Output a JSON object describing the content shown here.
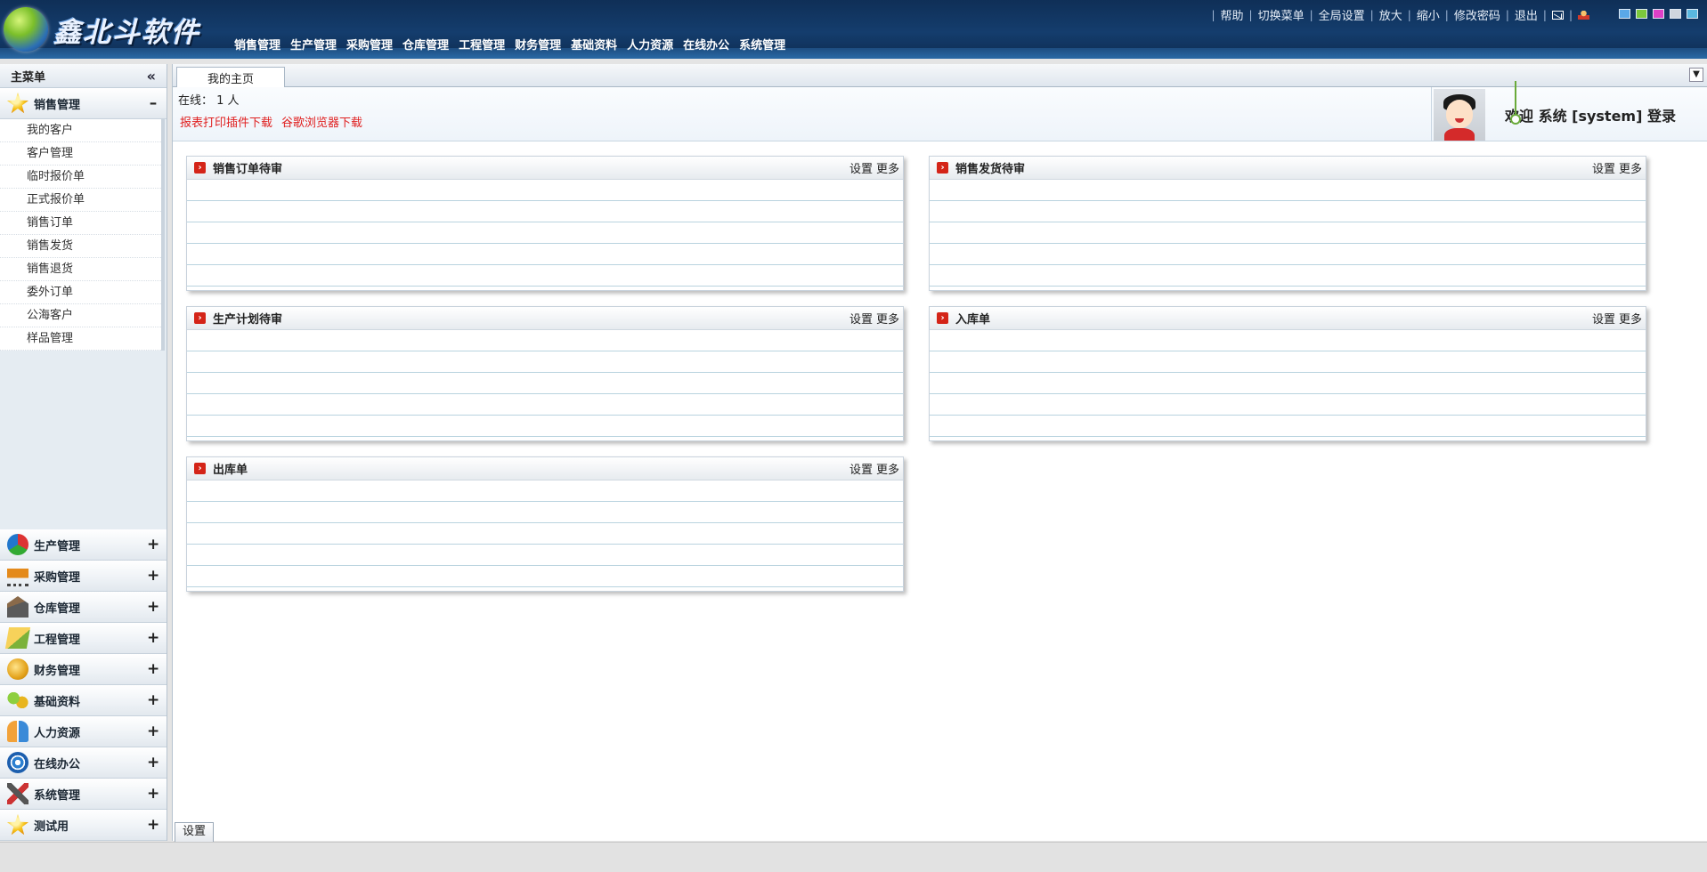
{
  "header": {
    "logo_text": "鑫北斗软件",
    "nav": [
      "销售管理",
      "生产管理",
      "采购管理",
      "仓库管理",
      "工程管理",
      "财务管理",
      "基础资料",
      "人力资源",
      "在线办公",
      "系统管理"
    ],
    "links": {
      "help": "帮助",
      "switch_menu": "切换菜单",
      "global_settings": "全局设置",
      "zoom_in": "放大",
      "zoom_out": "缩小",
      "change_password": "修改密码",
      "logout": "退出"
    },
    "swatch_colors": [
      "#5aa8e8",
      "#7cc83c",
      "#e040c8",
      "#cfd6de",
      "#5ab8e0"
    ]
  },
  "sidebar": {
    "title": "主菜单",
    "open_group": {
      "label": "销售管理",
      "toggle": "–",
      "items": [
        "我的客户",
        "客户管理",
        "临时报价单",
        "正式报价单",
        "销售订单",
        "销售发货",
        "销售退货",
        "委外订单",
        "公海客户",
        "样品管理"
      ]
    },
    "groups": [
      {
        "label": "生产管理",
        "toggle": "+"
      },
      {
        "label": "采购管理",
        "toggle": "+"
      },
      {
        "label": "仓库管理",
        "toggle": "+"
      },
      {
        "label": "工程管理",
        "toggle": "+"
      },
      {
        "label": "财务管理",
        "toggle": "+"
      },
      {
        "label": "基础资料",
        "toggle": "+"
      },
      {
        "label": "人力资源",
        "toggle": "+"
      },
      {
        "label": "在线办公",
        "toggle": "+"
      },
      {
        "label": "系统管理",
        "toggle": "+"
      },
      {
        "label": "测试用",
        "toggle": "+"
      }
    ]
  },
  "tabs": {
    "active": "我的主页"
  },
  "info": {
    "online": "在线： 1 人",
    "download_print": "报表打印插件下载",
    "download_chrome": "谷歌浏览器下载",
    "welcome": "欢迎 系统 [system] 登录"
  },
  "portlets": [
    {
      "title": "销售订单待审",
      "settings": "设置",
      "more": "更多"
    },
    {
      "title": "销售发货待审",
      "settings": "设置",
      "more": "更多"
    },
    {
      "title": "生产计划待审",
      "settings": "设置",
      "more": "更多"
    },
    {
      "title": "入库单",
      "settings": "设置",
      "more": "更多"
    },
    {
      "title": "出库单",
      "settings": "设置",
      "more": "更多"
    }
  ],
  "bottom": {
    "settings_button": "设置"
  }
}
